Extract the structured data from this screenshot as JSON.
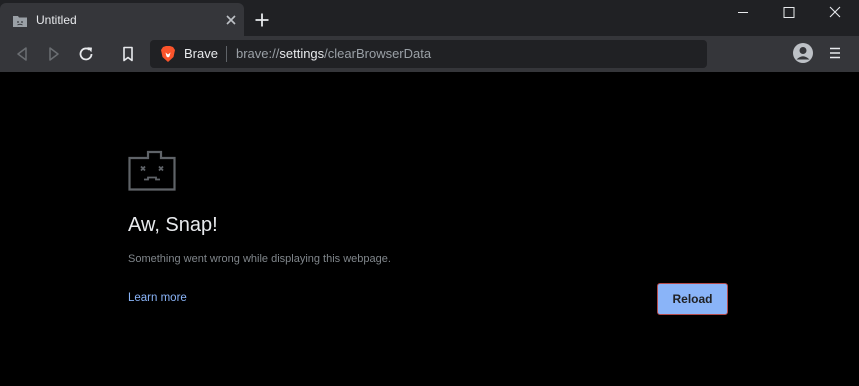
{
  "tab": {
    "title": "Untitled",
    "favicon": "sad-folder-icon"
  },
  "toolbar": {
    "omnibox": {
      "brand_label": "Brave",
      "url_prefix": "brave://",
      "url_host": "settings",
      "url_path": "/clearBrowserData"
    }
  },
  "error": {
    "icon": "sad-tab-icon",
    "title": "Aw, Snap!",
    "message": "Something went wrong while displaying this webpage.",
    "learn_more": "Learn more",
    "reload": "Reload"
  },
  "colors": {
    "page_background": "#000000",
    "toolbar": "#35363a",
    "link": "#8ab4f8",
    "button": "#8ab4f8",
    "button_border": "#b54b4b",
    "brave_brand": "#fb542b"
  }
}
